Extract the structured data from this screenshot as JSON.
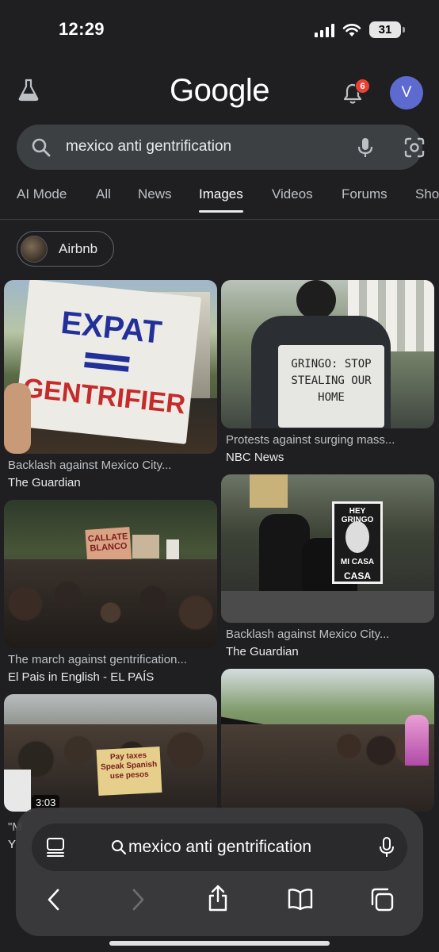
{
  "status": {
    "time": "12:29",
    "battery": "31"
  },
  "header": {
    "logo": "Google",
    "notifications": "6",
    "avatar_initial": "V"
  },
  "search": {
    "query": "mexico anti gentrification"
  },
  "tabs": [
    "AI Mode",
    "All",
    "News",
    "Images",
    "Videos",
    "Forums",
    "Sho"
  ],
  "active_tab": "Images",
  "chip": {
    "label": "Airbnb"
  },
  "results": [
    {
      "caption": "Backlash against Mexico City...",
      "source": "The Guardian",
      "sign": "EXPAT = GENTRIFIER"
    },
    {
      "caption": "Protests against surging mass...",
      "source": "NBC News",
      "sign": "GRINGO: STOP STEALING OUR HOME"
    },
    {
      "caption": "The march against gentrification...",
      "source": "El Pais in English - EL PAÍS",
      "sign": "CALLATE BLANCO"
    },
    {
      "caption": "Backlash against Mexico City...",
      "source": "The Guardian",
      "sign": "HEY GRINGO MI CASA CASA"
    },
    {
      "caption": "\"M",
      "source": "Y",
      "sign": "Pay taxes Speak Spanish use pesos",
      "video_duration": "3:03"
    },
    {
      "caption": "",
      "source": "",
      "sign": ""
    }
  ],
  "bottom": {
    "query": "mexico anti gentrification"
  },
  "colors": {
    "background": "#1f1f21",
    "search_bg": "#3c4043",
    "badge": "#e94235",
    "avatar": "#5d6bd1"
  }
}
